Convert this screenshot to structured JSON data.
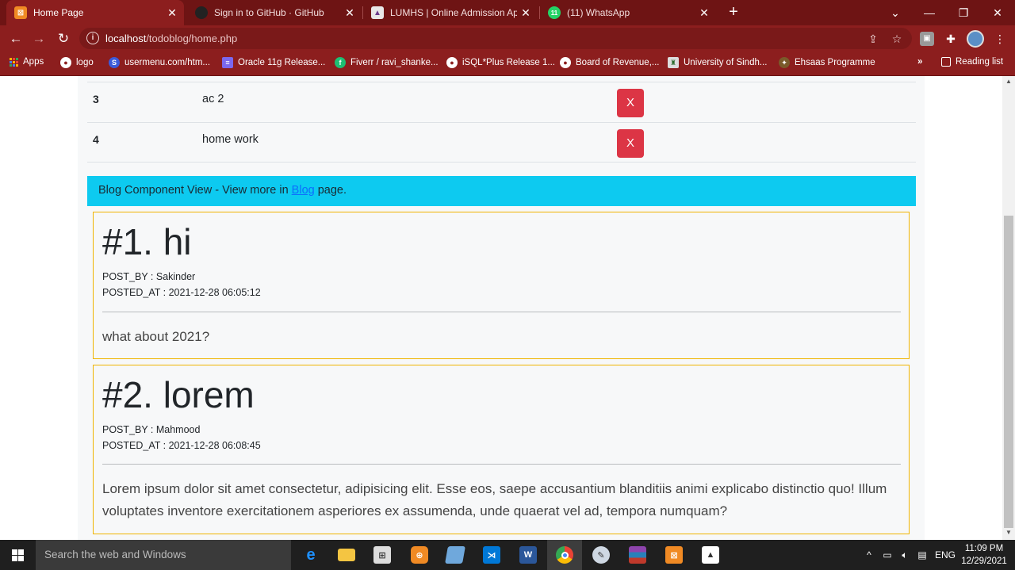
{
  "browser": {
    "tabs": [
      {
        "title": "Home Page",
        "active": true,
        "fav_color": "#f08a24",
        "fav_glyph": "⊠"
      },
      {
        "title": "Sign in to GitHub · GitHub",
        "active": false,
        "fav_color": "#222222",
        "fav_glyph": "●"
      },
      {
        "title": "LUMHS | Online Admission Applic",
        "active": false,
        "fav_color": "#e8e8e8",
        "fav_glyph": "▲"
      },
      {
        "title": "(11) WhatsApp",
        "active": false,
        "fav_color": "#25d366",
        "fav_glyph": "11"
      }
    ],
    "url_host": "localhost",
    "url_path": "/todoblog/home.php",
    "bookmarks": [
      {
        "label": "Apps",
        "color": "#f4b400"
      },
      {
        "label": "logo",
        "color": "#ffffff"
      },
      {
        "label": "usermenu.com/htm...",
        "color": "#3b5bdb"
      },
      {
        "label": "Oracle 11g Release...",
        "color": "#7b68ee"
      },
      {
        "label": "Fiverr / ravi_shanke...",
        "color": "#1dbf73"
      },
      {
        "label": "iSQL*Plus Release 1...",
        "color": "#ffffff"
      },
      {
        "label": "Board of Revenue,...",
        "color": "#ffffff"
      },
      {
        "label": "University of Sindh...",
        "color": "#dddddd"
      },
      {
        "label": "Ehsaas Programme",
        "color": "#7a5a2a"
      }
    ],
    "bookmarks_more": "»",
    "reading_list": "Reading list"
  },
  "todos": [
    {
      "num": "3",
      "text": "ac 2",
      "delete_label": "X"
    },
    {
      "num": "4",
      "text": "home work",
      "delete_label": "X"
    }
  ],
  "blog_alert": {
    "prefix": "Blog Component View - View more in ",
    "link": "Blog",
    "suffix": " page."
  },
  "posts": [
    {
      "title": "#1. hi",
      "posted_by": "POST_BY : Sakinder",
      "posted_at": "POSTED_AT : 2021-12-28 06:05:12",
      "content": "what about 2021?"
    },
    {
      "title": "#2. lorem",
      "posted_by": "POST_BY : Mahmood",
      "posted_at": "POSTED_AT : 2021-12-28 06:08:45",
      "content": "Lorem ipsum dolor sit amet consectetur, adipisicing elit. Esse eos, saepe accusantium blanditiis animi explicabo distinctio quo! Illum voluptates inventore exercitationem asperiores ex assumenda, unde quaerat vel ad, tempora numquam?"
    }
  ],
  "taskbar": {
    "search_placeholder": "Search the web and Windows",
    "language": "ENG",
    "time": "11:09 PM",
    "date": "12/29/2021"
  }
}
